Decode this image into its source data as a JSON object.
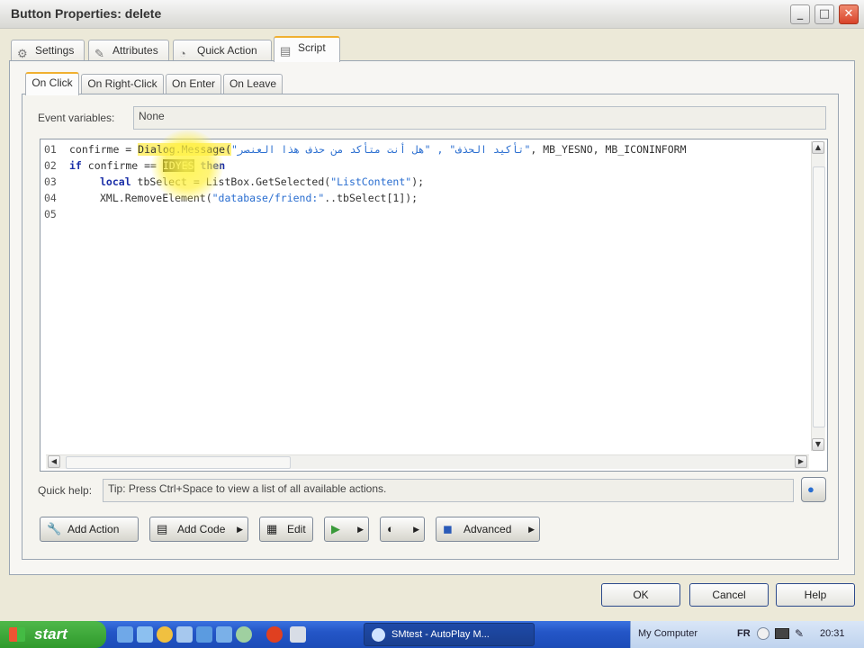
{
  "window": {
    "title": "Button Properties: delete",
    "controls": [
      "_",
      "□",
      "✕"
    ]
  },
  "outer_tabs": [
    {
      "label": "Settings",
      "icon": "settings-icon"
    },
    {
      "label": "Attributes",
      "icon": "attributes-icon"
    },
    {
      "label": "Quick Action",
      "icon": "quick-action-icon"
    },
    {
      "label": "Script",
      "icon": "script-icon",
      "active": true
    }
  ],
  "inner_tabs": [
    {
      "label": "On Click",
      "active": true
    },
    {
      "label": "On Right-Click"
    },
    {
      "label": "On Enter"
    },
    {
      "label": "On Leave"
    }
  ],
  "event_variables": {
    "label": "Event variables:",
    "value": "None"
  },
  "code": {
    "lines": [
      {
        "num": "01",
        "text_a": "confirme = ",
        "text_b": "Dialog.Message(",
        "text_c": "\"تأكيد الحذف\" , \"هل أنت متأكد من حذف هذا العنصر\"",
        "text_d": ", MB_YESNO, MB_ICONINFORM"
      },
      {
        "num": "02",
        "kw_a": "if",
        "text_a": " confirme == ",
        "hl": "IDYES",
        "kw_b": " then"
      },
      {
        "num": "03",
        "kw_a": "local",
        "text_a": " tbSelect = ListBox.GetSelected(",
        "str": "\"ListContent\"",
        "text_b": ");"
      },
      {
        "num": "04",
        "text_a": "XML.RemoveElement(",
        "str": "\"database/friend:\"",
        "text_b": "..tbSelect[1]);"
      },
      {
        "num": "05"
      }
    ]
  },
  "quick_help": {
    "label": "Quick help:",
    "value": "Tip: Press Ctrl+Space to view a list of all available actions."
  },
  "toolbar": {
    "add_action": "Add Action",
    "add_code": "Add Code",
    "edit": "Edit",
    "advanced": "Advanced"
  },
  "footer": {
    "ok": "OK",
    "cancel": "Cancel",
    "help": "Help"
  },
  "taskbar": {
    "start": "start",
    "task": "SMtest - AutoPlay M...",
    "tray_label": "My Computer",
    "lang": "FR",
    "clock": "20:31"
  },
  "colors": {
    "accent_tab": "#f0b030",
    "taskbar": "#2456c7",
    "start": "#3aa837"
  }
}
